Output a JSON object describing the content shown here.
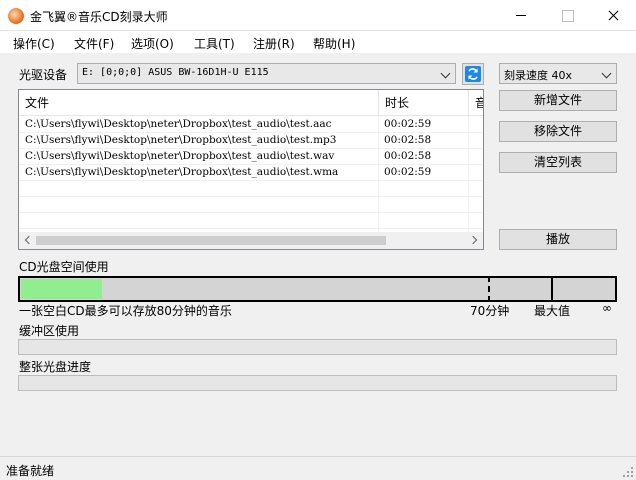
{
  "window": {
    "title": "金飞翼®音乐CD刻录大师",
    "icon": "flame-app-icon"
  },
  "menu": [
    {
      "label": "操作(C)"
    },
    {
      "label": "文件(F)"
    },
    {
      "label": "选项(O)"
    },
    {
      "label": "工具(T)"
    },
    {
      "label": "注册(R)"
    },
    {
      "label": "帮助(H)"
    }
  ],
  "drive": {
    "label": "光驱设备",
    "selected": "E:  [0;0;0] ASUS BW-16D1H-U E115",
    "refresh_icon": "refresh-icon"
  },
  "burn_speed": {
    "selected": "刻录速度 40x"
  },
  "buttons": {
    "add_file": "新增文件",
    "remove_file": "移除文件",
    "clear_list": "清空列表",
    "play": "播放"
  },
  "file_list": {
    "columns": [
      "文件",
      "时长",
      "音"
    ],
    "rows": [
      {
        "file": "C:\\Users\\flywi\\Desktop\\neter\\Dropbox\\test_audio\\test.aac",
        "duration": "00:02:59"
      },
      {
        "file": "C:\\Users\\flywi\\Desktop\\neter\\Dropbox\\test_audio\\test.mp3",
        "duration": "00:02:58"
      },
      {
        "file": "C:\\Users\\flywi\\Desktop\\neter\\Dropbox\\test_audio\\test.wav",
        "duration": "00:02:58"
      },
      {
        "file": "C:\\Users\\flywi\\Desktop\\neter\\Dropbox\\test_audio\\test.wma",
        "duration": "00:02:59"
      }
    ]
  },
  "cd_space": {
    "label": "CD光盘空间使用",
    "used_fraction": 0.136,
    "marker_70_fraction": 0.787,
    "marker_max_fraction": 0.893,
    "fill_color": "#90ee90",
    "caption": "一张空白CD最多可以存放80分钟的音乐",
    "tick_70": "70分钟",
    "tick_max": "最大值",
    "tick_infinity": "∞"
  },
  "buffer": {
    "label": "缓冲区使用",
    "value": 0
  },
  "disc_progress": {
    "label": "整张光盘进度",
    "value": 0
  },
  "status": {
    "text": "准备就绪"
  }
}
